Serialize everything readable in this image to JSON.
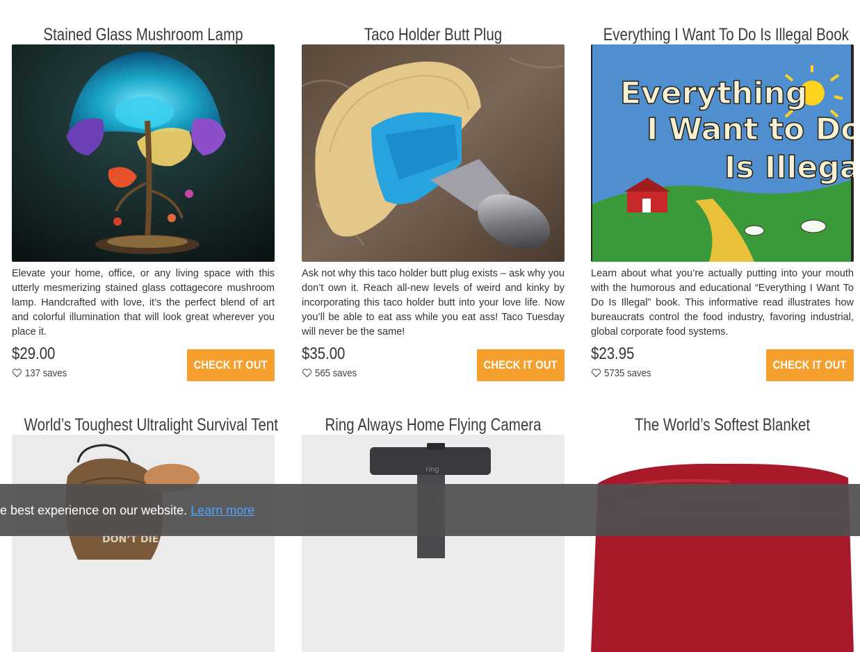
{
  "products": [
    {
      "title": "Stained Glass Mushroom Lamp",
      "description": "Elevate your home, office, or any living space with this utterly mesmerizing stained glass cottagecore mushroom lamp. Handcrafted with love, it’s the perfect blend of art and colorful illumination that will look great wherever you place it.",
      "price": "$29.00",
      "saves": "137 saves",
      "button_label": "CHECK IT OUT"
    },
    {
      "title": "Taco Holder Butt Plug",
      "description": "Ask not why this taco holder butt plug exists – ask why you don’t own it. Reach all-new levels of weird and kinky by incorporating this taco holder butt into your love life. Now you’ll be able to eat ass while you eat ass! Taco Tuesday will never be the same!",
      "price": "$35.00",
      "saves": "565 saves",
      "button_label": "CHECK IT OUT"
    },
    {
      "title": "Everything I Want To Do Is Illegal Book",
      "description": "Learn about what you’re actually putting into your mouth with the humorous and educational “Everything I Want To Do Is Illegal” book. This informative read illustrates how bureaucrats control the food industry, favoring industrial, global corporate food systems.",
      "price": "$23.95",
      "saves": "5735 saves",
      "button_label": "CHECK IT OUT",
      "cover_title_lines": [
        "Everything",
        "I Want to Do",
        "Is Illegal"
      ]
    },
    {
      "title": "World’s Toughest Ultralight Survival Tent",
      "image_text": "DON’T DIE"
    },
    {
      "title": "Ring Always Home Flying Camera",
      "image_text": "ring"
    },
    {
      "title": "The World’s Softest Blanket"
    }
  ],
  "cookie_banner": {
    "text": "e best experience on our website.",
    "link_label": "Learn more"
  },
  "colors": {
    "accent": "#f5a02e",
    "title": "#3b3b3b",
    "text": "#333333",
    "link": "#4da3ff",
    "banner": "#505050"
  },
  "icons": [
    "heart-outline-icon"
  ]
}
